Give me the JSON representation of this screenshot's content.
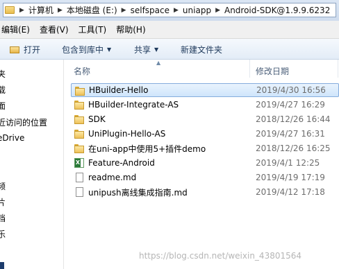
{
  "address": {
    "crumbs": [
      "计算机",
      "本地磁盘 (E:)",
      "selfspace",
      "uniapp",
      "Android-SDK@1.9.9.6232"
    ]
  },
  "menu": [
    "编辑(E)",
    "查看(V)",
    "工具(T)",
    "帮助(H)"
  ],
  "toolbar": {
    "open": "打开",
    "include": "包含到库中",
    "share": "共享",
    "new_folder": "新建文件夹"
  },
  "nav": [
    "夹",
    "载",
    "面",
    "近访问的位置",
    "eDrive",
    "频",
    "片",
    "档",
    "乐"
  ],
  "columns": {
    "name": "名称",
    "date": "修改日期"
  },
  "files": [
    {
      "name": "HBuilder-Hello",
      "date": "2019/4/30 16:56",
      "icon": "folder-icon",
      "selected": true
    },
    {
      "name": "HBuilder-Integrate-AS",
      "date": "2019/4/27 16:29",
      "icon": "folder-icon"
    },
    {
      "name": "SDK",
      "date": "2018/12/26 16:44",
      "icon": "folder-icon"
    },
    {
      "name": "UniPlugin-Hello-AS",
      "date": "2019/4/27 16:31",
      "icon": "folder-icon"
    },
    {
      "name": "在uni-app中使用5+插件demo",
      "date": "2018/12/26 16:25",
      "icon": "folder-icon"
    },
    {
      "name": "Feature-Android",
      "date": "2019/4/1 12:25",
      "icon": "excel-icon"
    },
    {
      "name": "readme.md",
      "date": "2019/4/19 17:19",
      "icon": "document-icon"
    },
    {
      "name": "unipush离线集成指南.md",
      "date": "2019/4/12 17:18",
      "icon": "document-icon"
    }
  ],
  "watermark": "https://blog.csdn.net/weixin_43801564"
}
